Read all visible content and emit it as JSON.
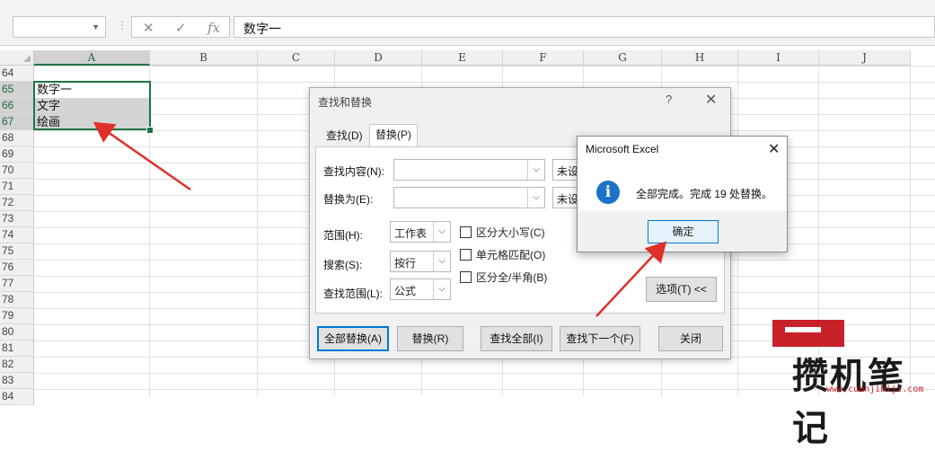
{
  "formula_bar": {
    "name_box_value": "",
    "cancel_glyph": "✕",
    "enter_glyph": "✓",
    "fx_glyph": "fx",
    "content": "数字一"
  },
  "columns": [
    "A",
    "B",
    "C",
    "D",
    "E",
    "F",
    "G",
    "H",
    "I",
    "J"
  ],
  "rows": [
    "64",
    "65",
    "66",
    "67",
    "68",
    "69",
    "70",
    "71",
    "72",
    "73",
    "74",
    "75",
    "76",
    "77",
    "78",
    "79",
    "80",
    "81",
    "82",
    "83",
    "84"
  ],
  "cells": {
    "A65": "数字一",
    "A66": "文字",
    "A67": "绘画"
  },
  "find_replace": {
    "title": "查找和替换",
    "help": "?",
    "close": "✕",
    "tab_find": "查找(D)",
    "tab_replace": "替换(P)",
    "find_what_label": "查找内容(N):",
    "replace_with_label": "替换为(E):",
    "format_clipped_1": "未设",
    "format_clipped_2": "未设",
    "scope_label": "范围(H):",
    "scope_value": "工作表",
    "search_label": "搜索(S):",
    "search_value": "按行",
    "look_in_label": "查找范围(L):",
    "look_in_value": "公式",
    "match_case": "区分大小写(C)",
    "match_entire": "单元格匹配(O)",
    "match_byte": "区分全/半角(B)",
    "options_button": "选项(T) <<",
    "replace_all": "全部替换(A)",
    "replace": "替换(R)",
    "find_all": "查找全部(I)",
    "find_next": "查找下一个(F)",
    "close_button": "关闭"
  },
  "message_box": {
    "title": "Microsoft Excel",
    "close": "✕",
    "icon_glyph": "i",
    "message": "全部完成。完成 19 处替换。",
    "ok": "确定"
  },
  "watermark": {
    "brand": "攒机笔记",
    "url": "www.cuanjibiji.com"
  },
  "colors": {
    "selection_green": "#217346",
    "arrow_red": "#e0302a",
    "info_blue": "#1a73c8",
    "logo_red": "#c9212a"
  }
}
